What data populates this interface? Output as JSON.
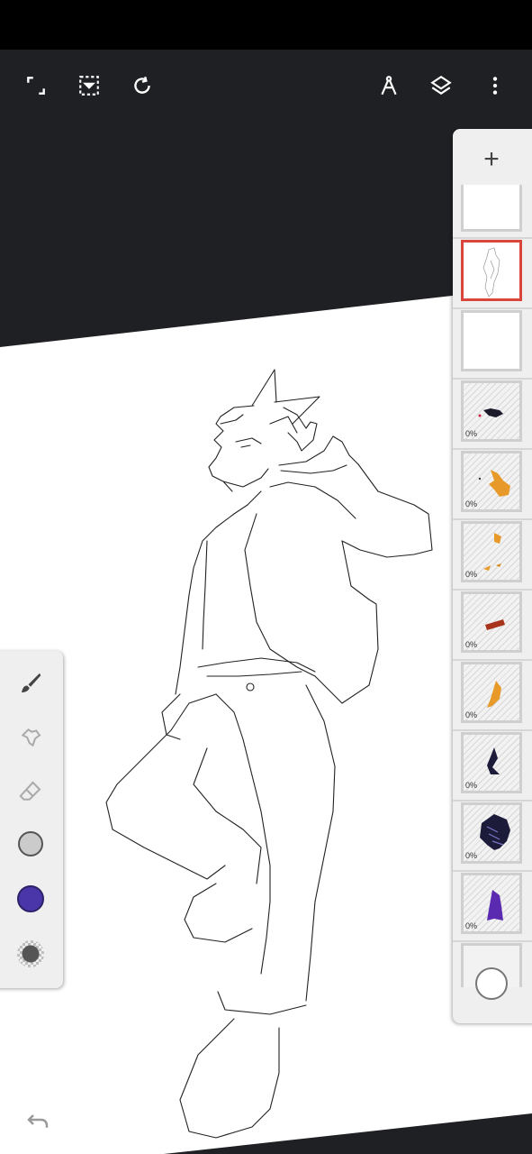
{
  "app": {
    "top_toolbar": {
      "buttons": [
        {
          "name": "fullscreen-icon"
        },
        {
          "name": "selection-icon"
        },
        {
          "name": "transform-rotate-icon"
        },
        {
          "name": "ruler-compass-icon"
        },
        {
          "name": "layers-icon"
        },
        {
          "name": "more-vert-icon"
        }
      ]
    },
    "colors": {
      "background": "#1f2023",
      "panel": "#efefef",
      "active_color": "#4a36a8",
      "selected_layer_border": "#d9463b"
    }
  },
  "layers_panel": {
    "add_label": "+",
    "layers": [
      {
        "opacity": "",
        "content": "empty-white",
        "selected": false
      },
      {
        "opacity": "",
        "content": "sketch-figure",
        "selected": true
      },
      {
        "opacity": "",
        "content": "empty-white",
        "selected": false
      },
      {
        "opacity": "0%",
        "content": "black-scribble",
        "selected": false
      },
      {
        "opacity": "0%",
        "content": "orange-hand",
        "selected": false
      },
      {
        "opacity": "0%",
        "content": "orange-fragments",
        "selected": false
      },
      {
        "opacity": "0%",
        "content": "red-stroke",
        "selected": false
      },
      {
        "opacity": "0%",
        "content": "orange-shape",
        "selected": false
      },
      {
        "opacity": "0%",
        "content": "navy-shape",
        "selected": false
      },
      {
        "opacity": "0%",
        "content": "navy-jacket",
        "selected": false
      },
      {
        "opacity": "0%",
        "content": "purple-shape",
        "selected": false
      }
    ]
  },
  "tool_panel": {
    "tools": [
      {
        "name": "brush-icon"
      },
      {
        "name": "smudge-icon"
      },
      {
        "name": "eraser-icon"
      },
      {
        "name": "secondary-color-swatch",
        "color": "#cbcbcb"
      },
      {
        "name": "primary-color-swatch",
        "color": "#4a36a8"
      },
      {
        "name": "opacity-swatch"
      }
    ]
  }
}
